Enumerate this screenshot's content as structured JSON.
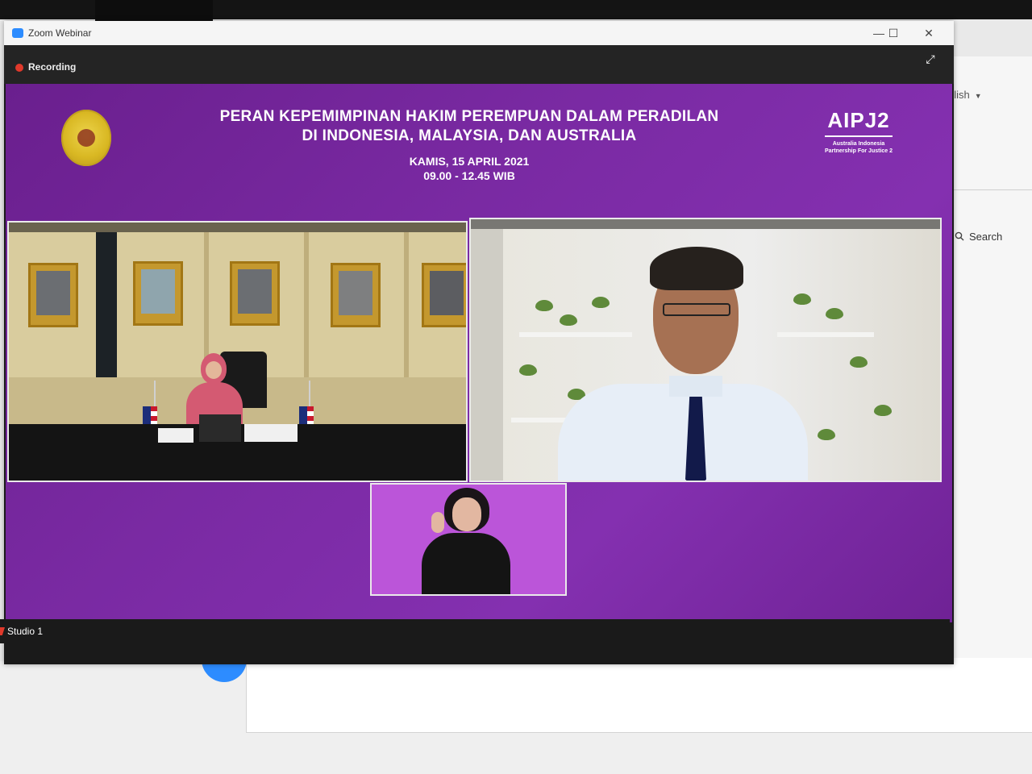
{
  "window": {
    "title": "Zoom Webinar",
    "recording_label": "Recording",
    "minimize": "—",
    "maximize": "☐",
    "close": "✕"
  },
  "slide": {
    "title_line1": "PERAN KEPEMIMPINAN HAKIM PEREMPUAN DALAM PERADILAN",
    "title_line2": "DI INDONESIA, MALAYSIA, DAN AUSTRALIA",
    "date_line": "KAMIS, 15 APRIL 2021",
    "time_line": "09.00 - 12.45 WIB",
    "logo_text": "AIPJ2",
    "logo_subtitle_1": "Australia Indonesia",
    "logo_subtitle_2": "Partnership For Justice 2"
  },
  "taskbar": {
    "item_label": "Studio 1"
  },
  "background_app": {
    "language_text": "glish",
    "search_label": "Search"
  },
  "colors": {
    "stage_purple": "#7a2aa3",
    "sign_panel": "#bb55d9",
    "recording_red": "#e0392b",
    "zoom_blue": "#2d8cff"
  },
  "icons": [
    "recording-dot-icon",
    "fullscreen-icon",
    "zoom-logo-icon",
    "search-icon",
    "chevron-down-icon",
    "court-seal-icon",
    "studio-app-icon"
  ]
}
